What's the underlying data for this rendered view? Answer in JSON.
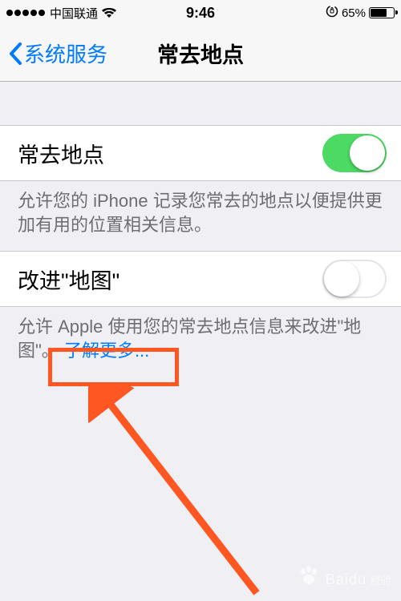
{
  "status": {
    "carrier": "中国联通",
    "time": "9:46",
    "battery_percent": "65%"
  },
  "nav": {
    "back_label": "系统服务",
    "title": "常去地点"
  },
  "section1": {
    "label": "常去地点",
    "footer": "允许您的 iPhone 记录您常去的地点以便提供更加有用的位置相关信息。"
  },
  "section2": {
    "label": "改进\"地图\"",
    "footer_prefix": "允许 Apple 使用您的常去地点信息来改进\"地图\"。",
    "footer_link": "了解更多..."
  },
  "watermark": {
    "brand": "Baidu",
    "sub": "经验"
  }
}
